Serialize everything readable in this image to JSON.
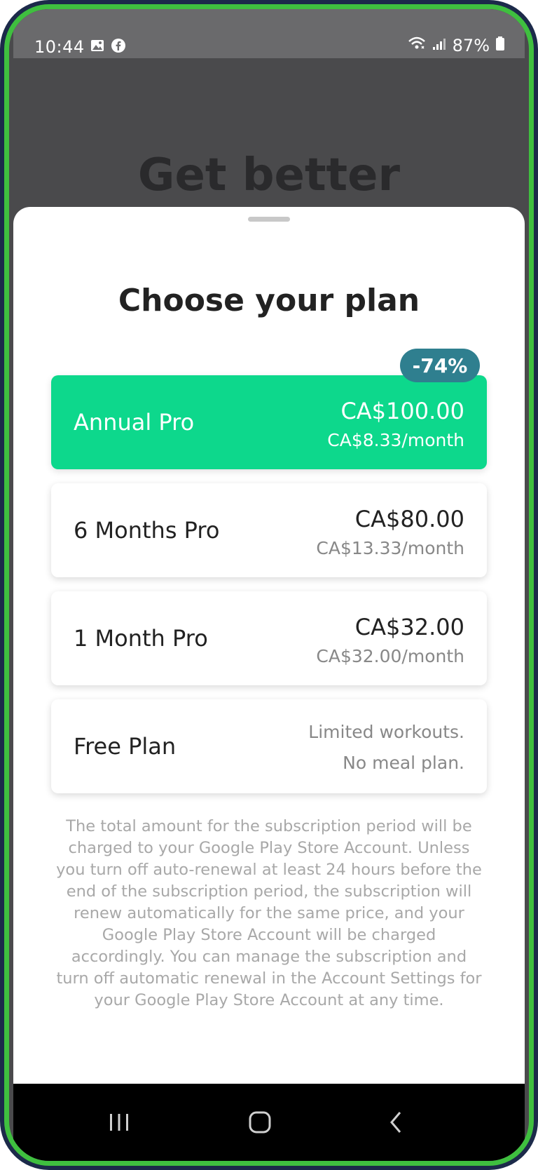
{
  "status_bar": {
    "time": "10:44",
    "battery": "87%",
    "icons": [
      "gallery-icon",
      "facebook-icon",
      "wifi-icon",
      "signal-icon",
      "battery-icon"
    ]
  },
  "background": {
    "title": "Get better"
  },
  "sheet": {
    "title": "Choose your plan",
    "plans": [
      {
        "name": "Annual Pro",
        "price": "CA$100.00",
        "monthly": "CA$8.33/month",
        "badge": "-74%",
        "selected": true
      },
      {
        "name": "6 Months Pro",
        "price": "CA$80.00",
        "monthly": "CA$13.33/month",
        "selected": false
      },
      {
        "name": "1 Month Pro",
        "price": "CA$32.00",
        "monthly": "CA$32.00/month",
        "selected": false
      },
      {
        "name": "Free Plan",
        "note_line1": "Limited workouts.",
        "note_line2": "No meal plan.",
        "selected": false
      }
    ],
    "legal_text": "The total amount for the subscription period will be charged to your Google Play Store Account. Unless you turn off auto-renewal at least 24 hours before the end of the subscription period, the subscription will renew automatically for the same price, and your Google Play Store Account will be charged accordingly. You can manage the subscription and turn off automatic renewal in the Account Settings for your Google Play Store Account at any time."
  },
  "nav_bar": {
    "buttons": [
      "recent-apps-icon",
      "home-icon",
      "back-icon"
    ]
  },
  "colors": {
    "selected_plan": "#0dd88c",
    "badge": "#2f7f8f",
    "frame_border": "#3fbf3f"
  }
}
